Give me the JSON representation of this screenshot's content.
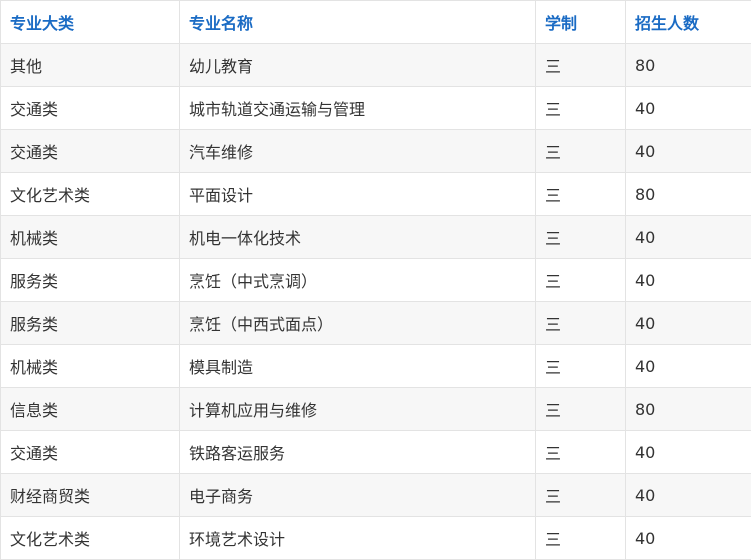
{
  "table": {
    "headers": [
      "专业大类",
      "专业名称",
      "学制",
      "招生人数"
    ],
    "rows": [
      [
        "其他",
        "幼儿教育",
        "三",
        "80"
      ],
      [
        "交通类",
        "城市轨道交通运输与管理",
        "三",
        "40"
      ],
      [
        "交通类",
        "汽车维修",
        "三",
        "40"
      ],
      [
        "文化艺术类",
        "平面设计",
        "三",
        "80"
      ],
      [
        "机械类",
        "机电一体化技术",
        "三",
        "40"
      ],
      [
        "服务类",
        "烹饪（中式烹调）",
        "三",
        "40"
      ],
      [
        "服务类",
        "烹饪（中西式面点）",
        "三",
        "40"
      ],
      [
        "机械类",
        "模具制造",
        "三",
        "40"
      ],
      [
        "信息类",
        "计算机应用与维修",
        "三",
        "80"
      ],
      [
        "交通类",
        "铁路客运服务",
        "三",
        "40"
      ],
      [
        "财经商贸类",
        "电子商务",
        "三",
        "40"
      ],
      [
        "文化艺术类",
        "环境艺术设计",
        "三",
        "40"
      ]
    ]
  },
  "colors": {
    "header_text": "#1a6bc4",
    "body_text": "#333333",
    "border": "#e3e3e3",
    "stripe": "#f7f7f7"
  }
}
